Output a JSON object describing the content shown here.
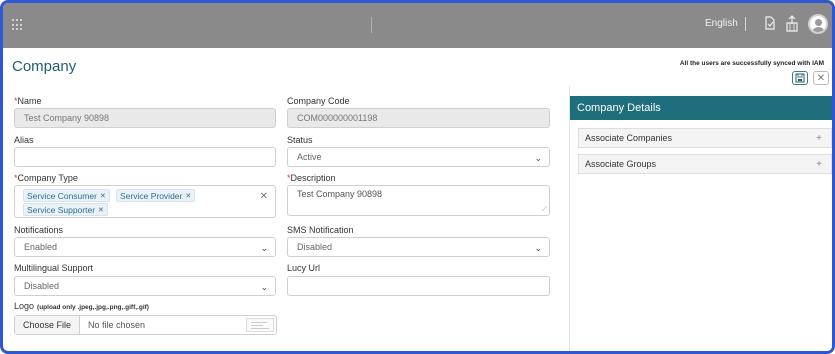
{
  "topbar": {
    "language": "English",
    "icons": [
      "apps-grid-icon",
      "document-icon",
      "upload-icon",
      "user-avatar-icon"
    ]
  },
  "page": {
    "title": "Company",
    "sync_message": "All the users are successfully synced with IAM"
  },
  "form": {
    "name": {
      "label": "Name",
      "required_mark": "*",
      "value": "Test Company 90898"
    },
    "company_code": {
      "label": "Company Code",
      "value": "COM000000001198"
    },
    "alias": {
      "label": "Alias",
      "value": ""
    },
    "status": {
      "label": "Status",
      "value": "Active"
    },
    "company_type": {
      "label": "Company Type",
      "required_mark": "*",
      "tags": [
        "Service Consumer",
        "Service Provider",
        "Service Supporter"
      ]
    },
    "description": {
      "label": "Description",
      "required_mark": "*",
      "value": "Test Company 90898"
    },
    "notifications": {
      "label": "Notifications",
      "value": "Enabled"
    },
    "sms_notification": {
      "label": "SMS Notification",
      "value": "Disabled"
    },
    "multilingual": {
      "label": "Multilingual Support",
      "value": "Disabled"
    },
    "lucy_url": {
      "label": "Lucy Url",
      "value": ""
    },
    "logo": {
      "label": "Logo",
      "hint": "(upload only .jpeg,.jpg,.png,.giff,.gif)",
      "choose_label": "Choose File",
      "status": "No file chosen"
    }
  },
  "details_panel": {
    "title": "Company Details",
    "items": [
      "Associate Companies",
      "Associate Groups"
    ]
  },
  "colors": {
    "accent": "#1f6e7e",
    "topbar": "#8a8a8a",
    "required": "#d9341f",
    "tag_text": "#2a6f95"
  }
}
